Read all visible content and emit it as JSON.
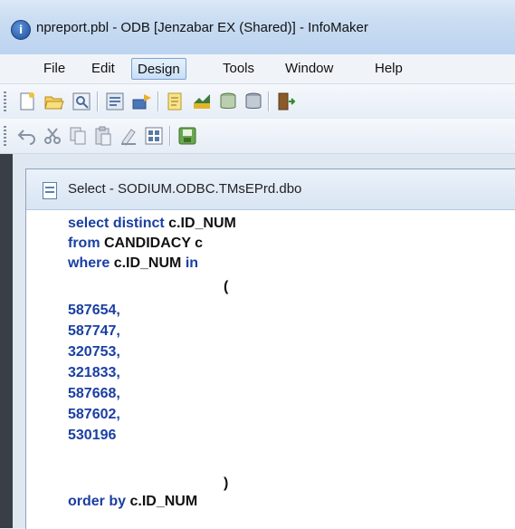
{
  "window": {
    "icon_glyph": "i",
    "title": "npreport.pbl - ODB [Jenzabar EX (Shared)] - InfoMaker"
  },
  "menu": {
    "items": [
      "File",
      "Edit",
      "Design",
      "Tools",
      "Window",
      "Help"
    ],
    "active": "Design"
  },
  "toolbar1": {
    "icons": [
      "new-icon",
      "open-icon",
      "preview-icon",
      "library-icon",
      "datawindow-icon",
      "query-icon",
      "report-icon",
      "database-icon",
      "db-profile-icon",
      "exit-icon"
    ]
  },
  "toolbar2": {
    "icons": [
      "undo-icon",
      "cut-icon",
      "copy-icon",
      "paste-icon",
      "clear-icon",
      "select-all-icon",
      "save-icon"
    ]
  },
  "editor": {
    "title": "Select - SODIUM.ODBC.TMsEPrd.dbo",
    "lines": {
      "l1_kw": "select distinct ",
      "l1_rest": "c.ID_NUM",
      "l2_kw": "from ",
      "l2_rest": "CANDIDACY c",
      "l3_kw": "where ",
      "l3_mid": "c.ID_NUM ",
      "l3_kw2": "in",
      "l4": "(",
      "n1": "587654,",
      "n2": "587747,",
      "n3": "320753,",
      "n4": "321833,",
      "n5": "587668,",
      "n6": "587602,",
      "n7": "530196",
      "l12": ")",
      "l13_kw": "order by ",
      "l13_rest": "c.ID_NUM"
    }
  }
}
